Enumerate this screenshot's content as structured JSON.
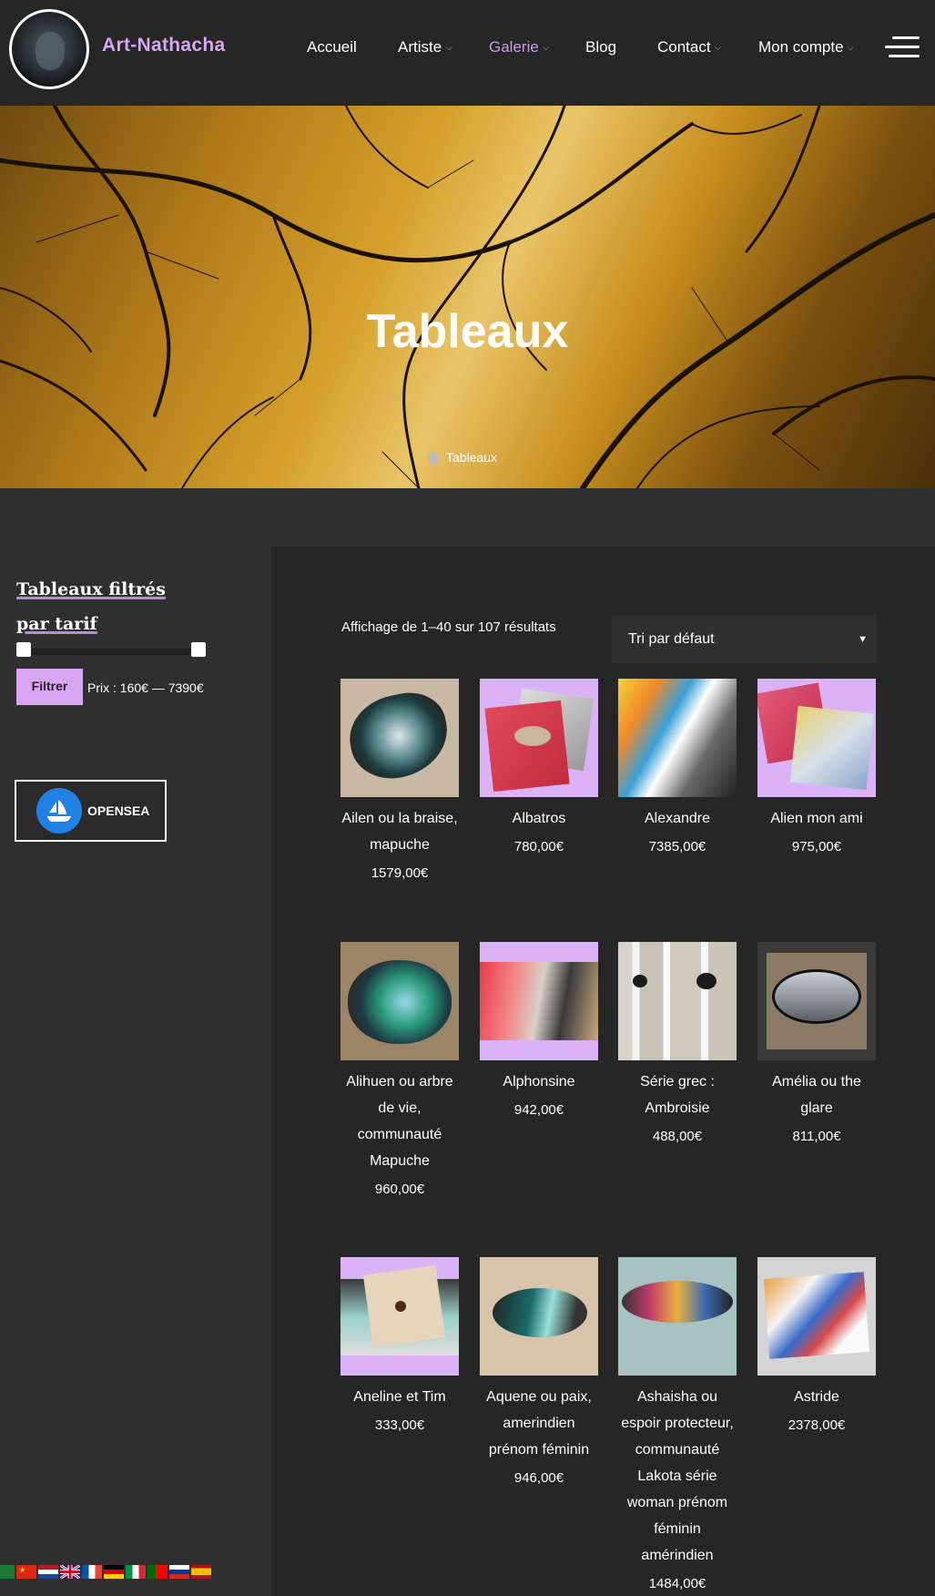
{
  "header": {
    "brand": "Art-Nathacha",
    "nav": [
      {
        "label": "Accueil",
        "dropdown": false,
        "active": false
      },
      {
        "label": "Artiste",
        "dropdown": true,
        "active": false
      },
      {
        "label": "Galerie",
        "dropdown": true,
        "active": true
      },
      {
        "label": "Blog",
        "dropdown": false,
        "active": false
      },
      {
        "label": "Contact",
        "dropdown": true,
        "active": false
      },
      {
        "label": "Mon compte",
        "dropdown": true,
        "active": false
      }
    ],
    "menu_icon": "hamburger-icon",
    "accent_color": "#d8a6f0"
  },
  "hero": {
    "title": "Tableaux",
    "breadcrumb": "Tableaux",
    "breadcrumb_icon": "home-icon"
  },
  "sidebar": {
    "widget_title": "Tableaux filtrés par tarif",
    "filter_button": "Filtrer",
    "price_range": "Prix : 160€ — 7390€",
    "opensea_label": "OPENSEA",
    "languages": [
      "ar",
      "zh",
      "nl",
      "en",
      "fr",
      "de",
      "it",
      "pt",
      "ru",
      "es"
    ]
  },
  "shop": {
    "result_count": "Affichage de 1–40 sur 107 résultats",
    "sort_selected": "Tri par défaut",
    "products": [
      {
        "name": "Ailen ou la braise, mapuche",
        "price": "1579,00€"
      },
      {
        "name": "Albatros",
        "price": "780,00€"
      },
      {
        "name": "Alexandre",
        "price": "7385,00€"
      },
      {
        "name": "Alien mon ami",
        "price": "975,00€"
      },
      {
        "name": "Alihuen ou arbre de vie, communauté Mapuche",
        "price": "960,00€"
      },
      {
        "name": "Alphonsine",
        "price": "942,00€"
      },
      {
        "name": "Série grec : Ambroisie",
        "price": "488,00€"
      },
      {
        "name": "Amélia ou the glare",
        "price": "811,00€"
      },
      {
        "name": "Aneline et Tim",
        "price": "333,00€"
      },
      {
        "name": "Aquene ou paix, amerindien prénom féminin",
        "price": "946,00€"
      },
      {
        "name": "Ashaisha ou espoir protecteur, communauté Lakota série woman prénom féminin amérindien",
        "price": "1484,00€"
      },
      {
        "name": "Astride",
        "price": "2378,00€"
      }
    ]
  }
}
